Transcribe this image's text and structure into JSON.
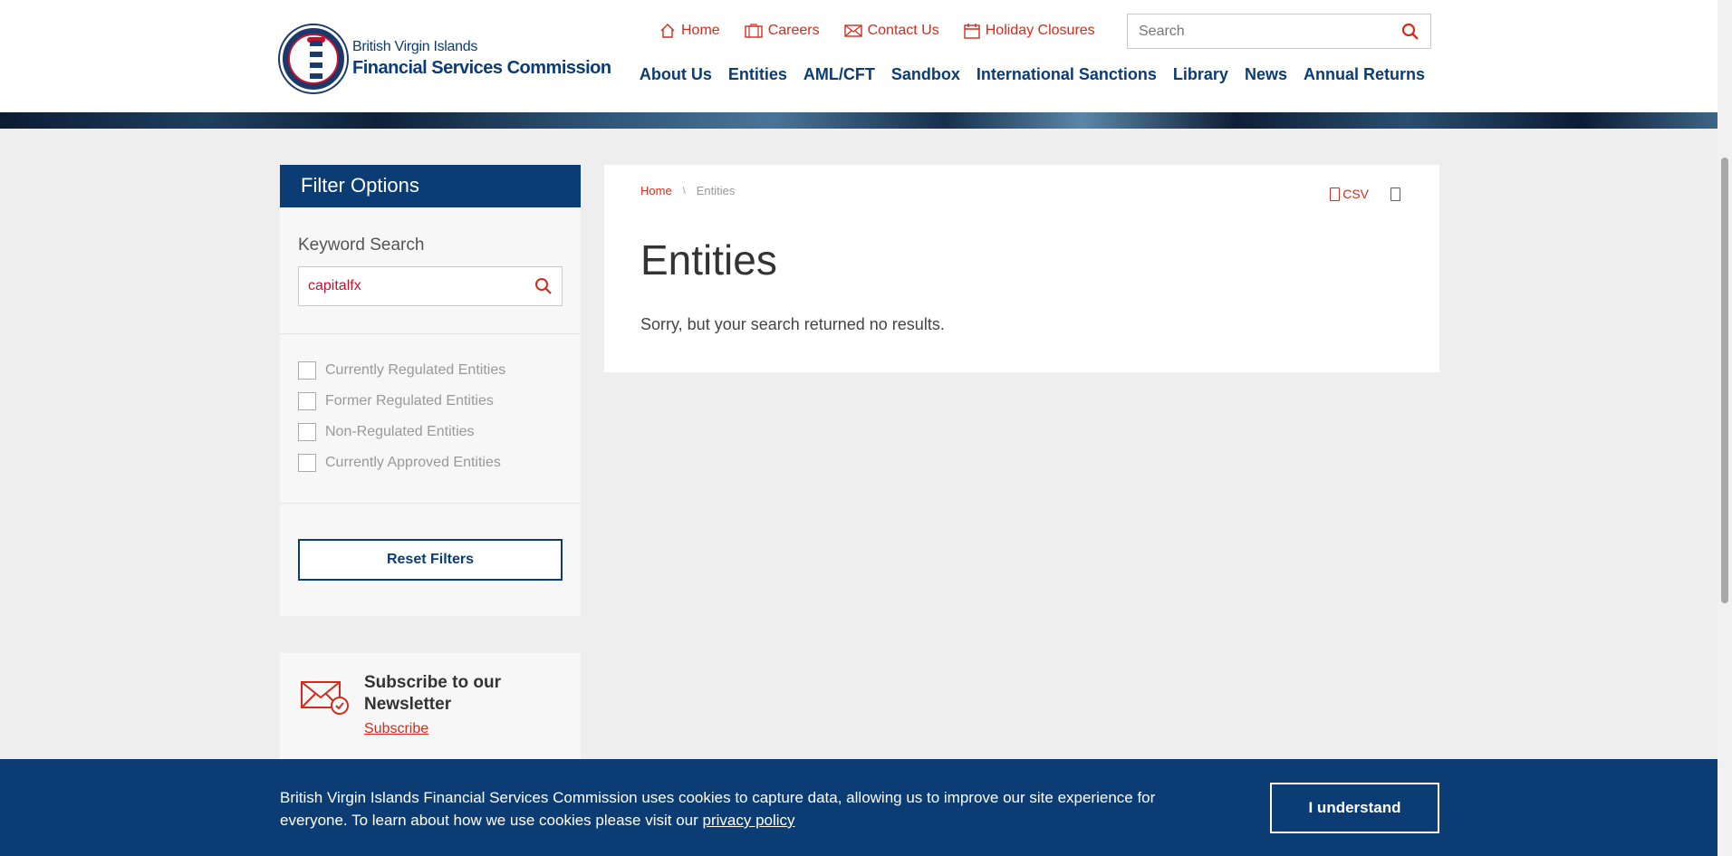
{
  "header": {
    "logo_line1": "British Virgin Islands",
    "logo_line2": "Financial Services Commission",
    "utility": [
      {
        "label": "Home",
        "icon": "home-icon"
      },
      {
        "label": "Careers",
        "icon": "briefcase-icon"
      },
      {
        "label": "Contact Us",
        "icon": "mail-icon"
      },
      {
        "label": "Holiday Closures",
        "icon": "calendar-icon"
      }
    ],
    "search_placeholder": "Search",
    "nav": [
      "About Us",
      "Entities",
      "AML/CFT",
      "Sandbox",
      "International Sanctions",
      "Library",
      "News",
      "Annual Returns"
    ]
  },
  "filter": {
    "title": "Filter Options",
    "keyword_label": "Keyword Search",
    "keyword_value": "capitalfx",
    "options": [
      "Currently Regulated Entities",
      "Former Regulated Entities",
      "Non-Regulated Entities",
      "Currently Approved Entities"
    ],
    "reset_label": "Reset Filters"
  },
  "newsletter": {
    "title": "Subscribe to our Newsletter",
    "link": "Subscribe"
  },
  "main": {
    "breadcrumb_home": "Home",
    "breadcrumb_sep": "\\",
    "breadcrumb_current": "Entities",
    "csv_label": "CSV",
    "title": "Entities",
    "message": "Sorry, but your search returned no results."
  },
  "cookie": {
    "text": "British Virgin Islands Financial Services Commission uses cookies to capture data, allowing us to improve our site experience for everyone. To learn about how we use cookies please visit our ",
    "link": "privacy policy",
    "button": "I understand"
  },
  "colors": {
    "brand_navy": "#0b3c74",
    "accent_red": "#d32c1c"
  }
}
